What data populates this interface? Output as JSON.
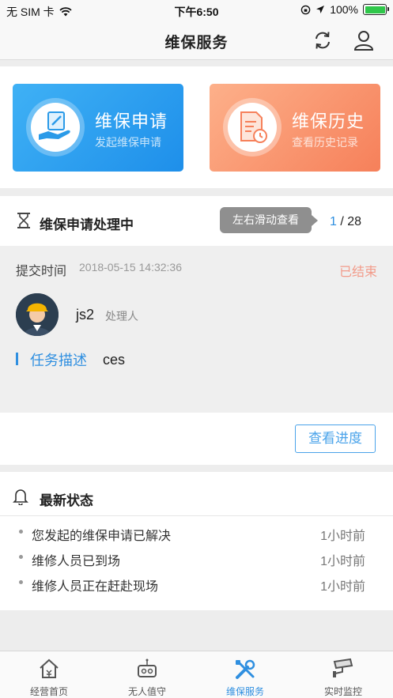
{
  "status_bar": {
    "carrier": "无 SIM 卡",
    "time": "下午6:50",
    "battery": "100%"
  },
  "nav": {
    "title": "维保服务",
    "refresh_icon": "refresh-icon",
    "user_icon": "user-icon"
  },
  "cards": [
    {
      "title": "维保申请",
      "subtitle": "发起维保申请",
      "icon": "apply-hand-icon",
      "color": "#1e8fea"
    },
    {
      "title": "维保历史",
      "subtitle": "查看历史记录",
      "icon": "history-document-icon",
      "color": "#f6805a"
    }
  ],
  "processing": {
    "title": "维保申请处理中",
    "tooltip": "左右滑动查看",
    "current": "1",
    "separator": " / ",
    "total": "28",
    "submit_label": "提交时间",
    "submit_time": "2018-05-15 14:32:36",
    "status": "已结束",
    "handler_name": "js2",
    "handler_role": "处理人",
    "task_label": "任务描述",
    "task_value": "ces",
    "progress_button": "查看进度"
  },
  "latest": {
    "title": "最新状态",
    "items": [
      {
        "text": "您发起的维保申请已解决",
        "time": "1小时前"
      },
      {
        "text": "维修人员已到场",
        "time": "1小时前"
      },
      {
        "text": "维修人员正在赶赴现场",
        "time": "1小时前"
      }
    ]
  },
  "tabs": [
    {
      "label": "经营首页",
      "icon": "home-icon",
      "active": false
    },
    {
      "label": "无人值守",
      "icon": "robot-icon",
      "active": false
    },
    {
      "label": "维保服务",
      "icon": "tools-icon",
      "active": true
    },
    {
      "label": "实时监控",
      "icon": "camera-icon",
      "active": false
    }
  ],
  "colors": {
    "accent": "#2f8fe0",
    "ended": "#f29b8a"
  }
}
